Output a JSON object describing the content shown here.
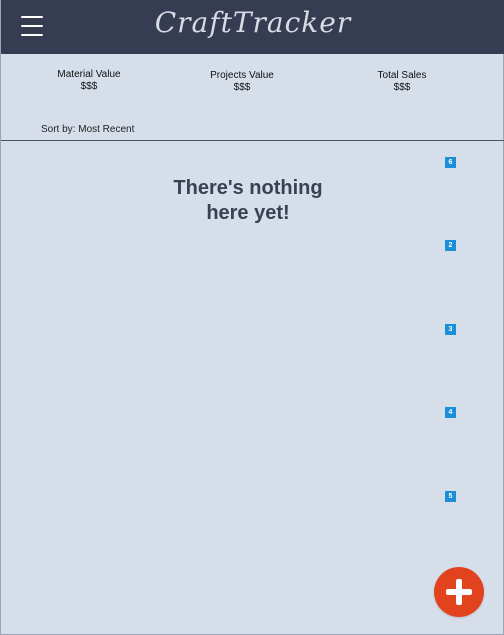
{
  "header": {
    "logo_text": "CraftTracker",
    "menu_icon": "hamburger-menu-icon",
    "background": "#363d52"
  },
  "stats": {
    "material": {
      "label": "Material Value",
      "value": "$$$"
    },
    "projects": {
      "label": "Projects Value",
      "value": "$$$"
    },
    "sales": {
      "label": "Total Sales",
      "value": "$$$"
    }
  },
  "sort": {
    "label": "Sort by: Most Recent"
  },
  "empty_state": {
    "line1": "There's nothing",
    "line2": "here yet!"
  },
  "page_badges": [
    "6",
    "2",
    "3",
    "4",
    "5"
  ],
  "fab": {
    "icon": "plus-icon",
    "color": "#e2431f"
  },
  "colors": {
    "background": "#d6deea",
    "accent": "#1a8fd8"
  }
}
